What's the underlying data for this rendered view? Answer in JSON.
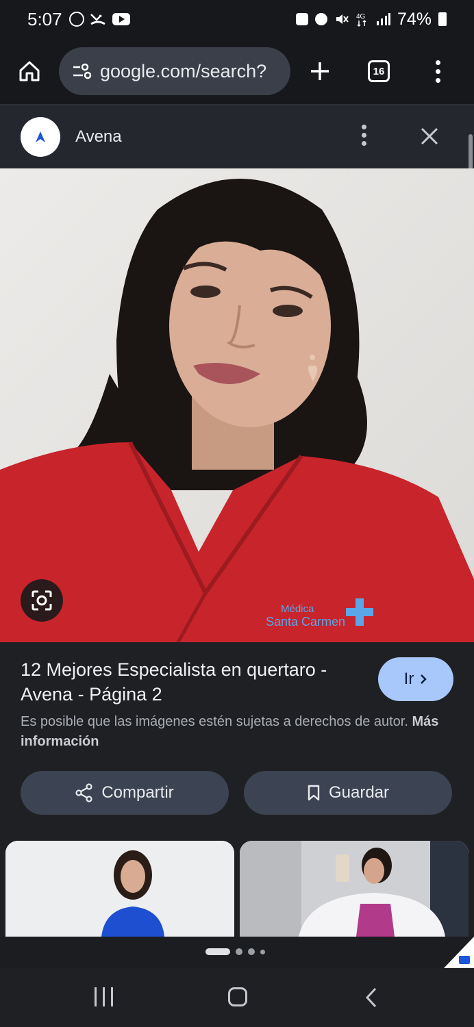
{
  "status_bar": {
    "time": "5:07",
    "battery": "74%",
    "left_icons": [
      "whatsapp-icon",
      "missed-call-icon",
      "youtube-icon"
    ],
    "right_icons": [
      "notification-box-icon",
      "alarm-icon",
      "mute-icon",
      "network-4g-icon",
      "signal-icon",
      "battery-icon"
    ]
  },
  "toolbar": {
    "url": "google.com/search?",
    "tab_count": "16"
  },
  "sheet": {
    "site_name": "Avena"
  },
  "result": {
    "title": "12 Mejores Especialista en quertaro - Avena - Página 2",
    "go_label": "Ir",
    "copyright_text": "Es posible que las imágenes estén sujetas a derechos de autor.",
    "more_info_label": "Más información",
    "share_label": "Compartir",
    "save_label": "Guardar"
  },
  "photo": {
    "scrub_logo_line1": "Médica",
    "scrub_logo_line2": "Santa Carmen"
  },
  "colors": {
    "background": "#1f2023",
    "toolbar": "#16181c",
    "urlbar": "#3a3f4a",
    "accent_button": "#a8c7fa",
    "action_button": "#3c4453",
    "scrubs_red": "#c8242b"
  }
}
